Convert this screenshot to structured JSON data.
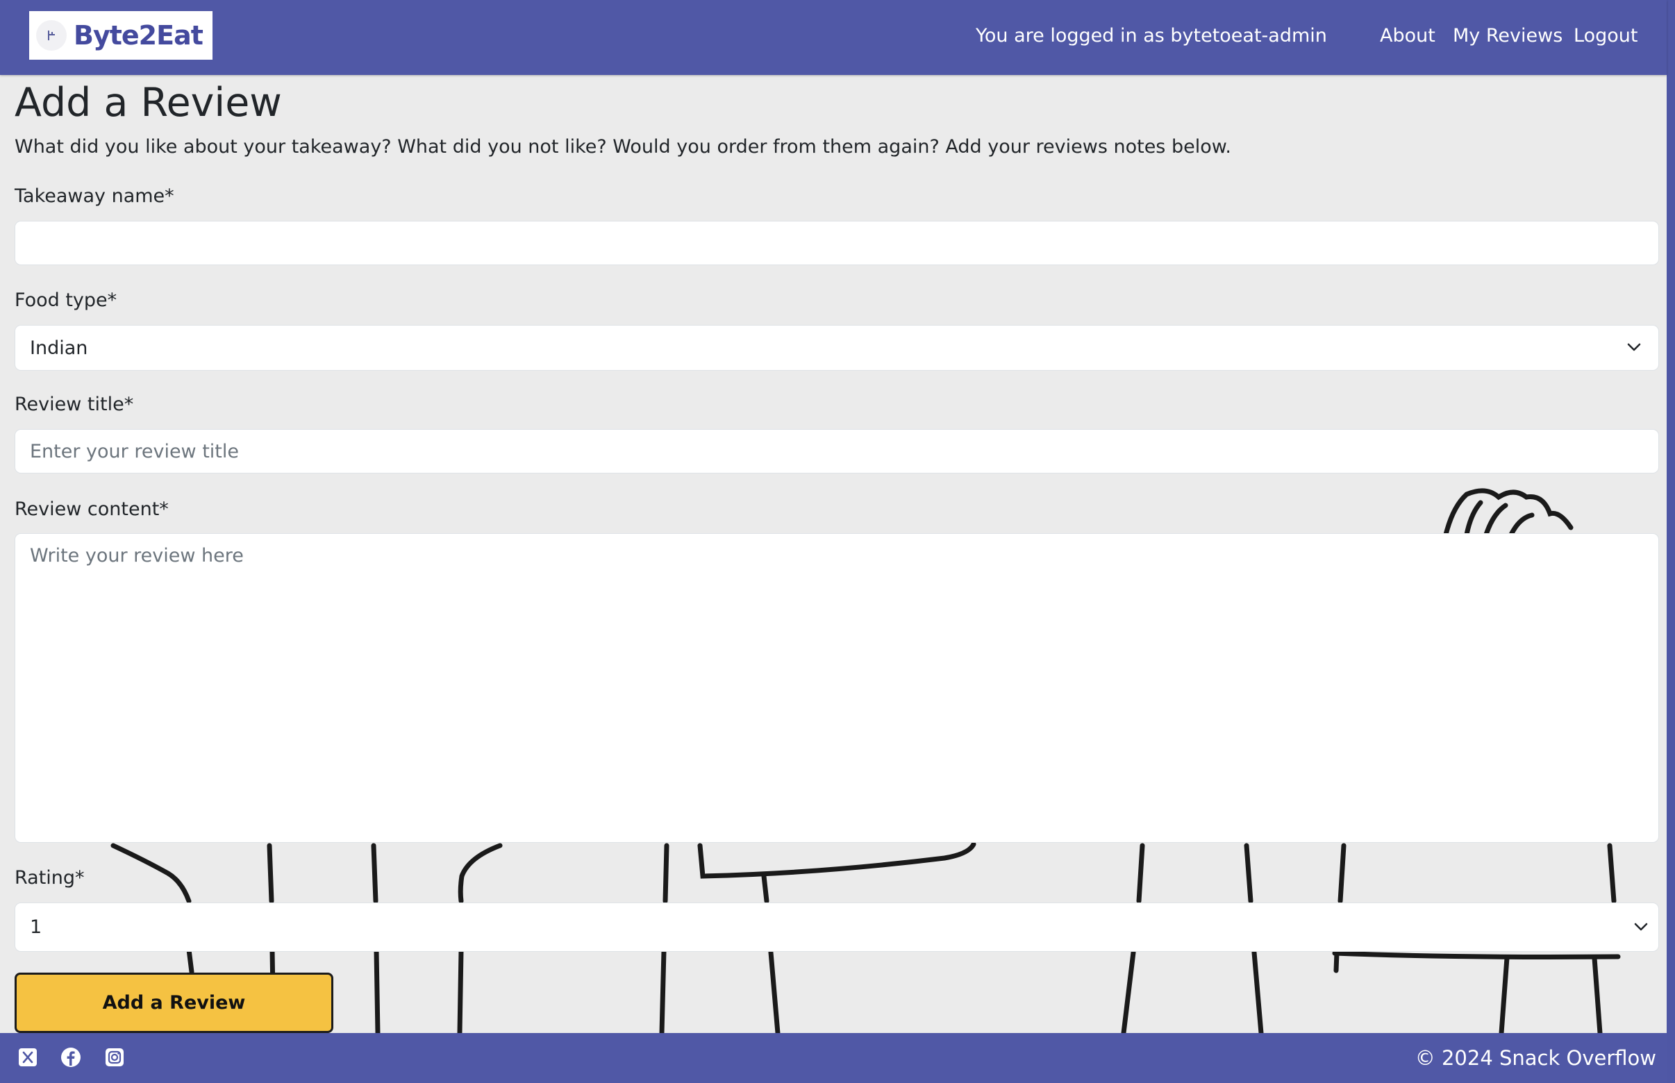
{
  "navbar": {
    "brand": "Byte2Eat",
    "logged_in_text": "You are logged in as bytetoeat-admin",
    "links": {
      "about": "About",
      "my_reviews": "My Reviews",
      "logout": "Logout"
    }
  },
  "page": {
    "title": "Add a Review",
    "intro": "What did you like about your takeaway? What did you not like? Would you order from them again? Add your reviews notes below."
  },
  "form": {
    "takeaway_name": {
      "label": "Takeaway name*",
      "value": "",
      "placeholder": ""
    },
    "food_type": {
      "label": "Food type*",
      "selected": "Indian",
      "icon": "chevron-down-icon"
    },
    "review_title": {
      "label": "Review title*",
      "placeholder": "Enter your review title"
    },
    "review_content": {
      "label": "Review content*",
      "placeholder": "Write your review here"
    },
    "rating": {
      "label": "Rating*",
      "selected": "1",
      "icon": "chevron-down-icon"
    },
    "submit_label": "Add a Review"
  },
  "footer": {
    "social_icons": [
      "x-twitter-icon",
      "facebook-icon",
      "instagram-icon"
    ],
    "copyright": "© 2024 Snack Overflow"
  },
  "colors": {
    "navbar": "#5058a6",
    "page_background": "#ebebeb",
    "button": "#f5c242",
    "footer": "#5058a6"
  }
}
